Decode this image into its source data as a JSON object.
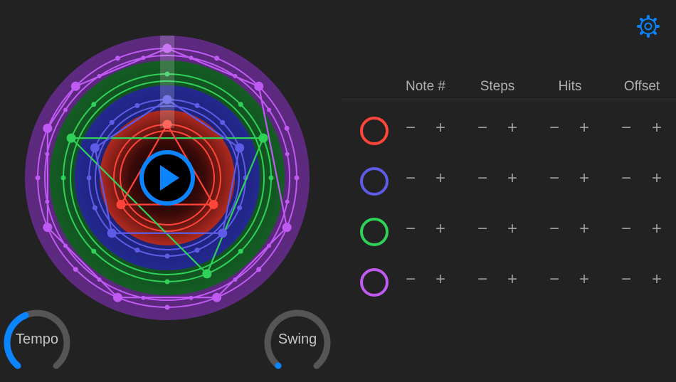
{
  "columns": [
    "Note #",
    "Steps",
    "Hits",
    "Offset"
  ],
  "tracks": [
    {
      "color": "#ff453a",
      "name": "red"
    },
    {
      "color": "#5e5ce6",
      "name": "blue"
    },
    {
      "color": "#30d158",
      "name": "green"
    },
    {
      "color": "#bf5af2",
      "name": "purple"
    }
  ],
  "controls": {
    "minus": "−",
    "plus": "+"
  },
  "knobs": {
    "tempo": {
      "label": "Tempo",
      "value": 0.42,
      "accent": "#0a84ff"
    },
    "swing": {
      "label": "Swing",
      "value": 0.0,
      "accent": "#0a84ff"
    }
  },
  "accent": "#0a84ff"
}
